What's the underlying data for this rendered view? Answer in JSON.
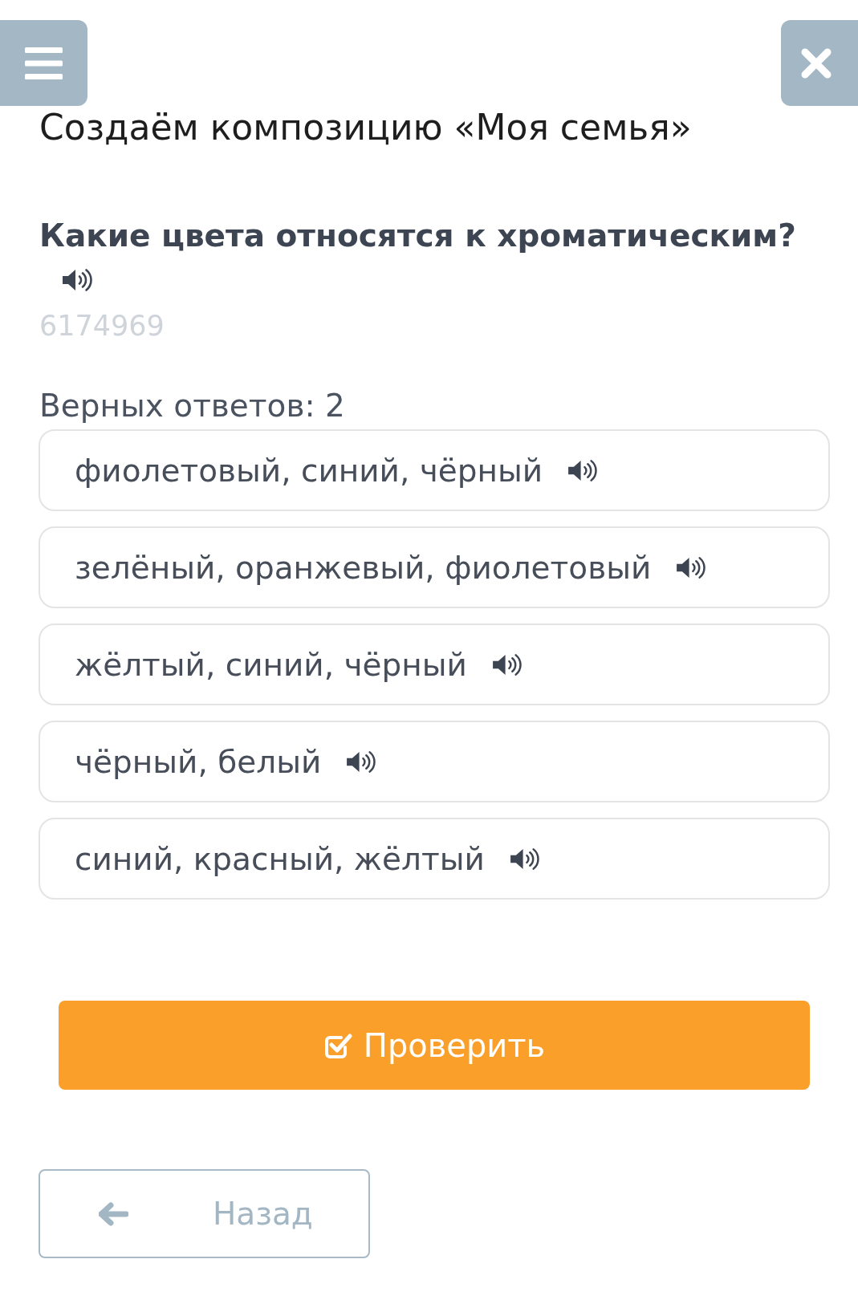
{
  "title": "Создаём композицию «Моя семья»",
  "question": {
    "text": "Какие цвета относятся к хроматическим?",
    "task_id": "6174969"
  },
  "answers_count": "Верных ответов: 2",
  "options": [
    {
      "label": "фиолетовый, синий, чёрный",
      "selected": false
    },
    {
      "label": "зелёный, оранжевый, фиолетовый",
      "selected": false
    },
    {
      "label": "жёлтый, синий, чёрный",
      "selected": false
    },
    {
      "label": "чёрный, белый",
      "selected": false
    },
    {
      "label": "синий, красный, жёлтый",
      "selected": false
    }
  ],
  "buttons": {
    "check": "Проверить",
    "back": "Назад"
  }
}
